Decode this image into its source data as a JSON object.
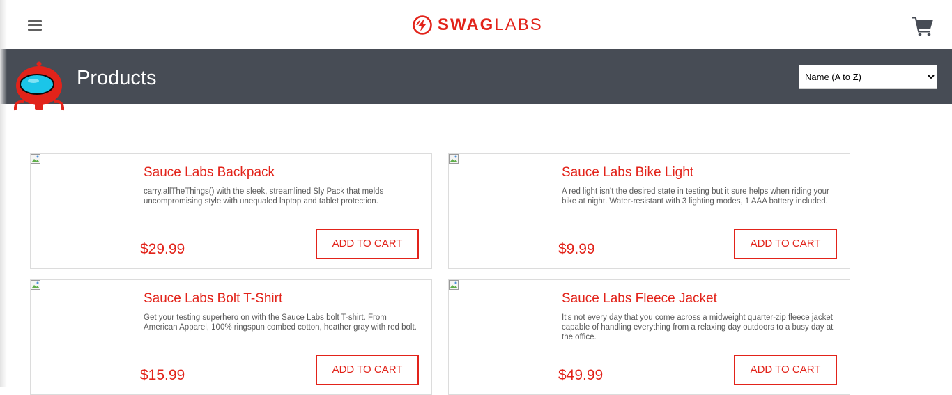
{
  "header": {
    "logo_bold": "SWAG",
    "logo_light": "LABS",
    "menu_icon": "hamburger-menu-icon",
    "cart_icon": "shopping-cart-icon",
    "brand_color": "#e2231a"
  },
  "subheader": {
    "title": "Products",
    "mascot_icon": "robot-mascot-icon",
    "background": "#474c55"
  },
  "sort": {
    "selected": "Name (A to Z)",
    "options": [
      "Name (A to Z)"
    ]
  },
  "products": [
    {
      "name": "Sauce Labs Backpack",
      "description": "carry.allTheThings() with the sleek, streamlined Sly Pack that melds uncompromising style with unequaled laptop and tablet protection.",
      "price": "$29.99",
      "button": "ADD TO CART"
    },
    {
      "name": "Sauce Labs Bike Light",
      "description": "A red light isn't the desired state in testing but it sure helps when riding your bike at night. Water-resistant with 3 lighting modes, 1 AAA battery included.",
      "price": "$9.99",
      "button": "ADD TO CART"
    },
    {
      "name": "Sauce Labs Bolt T-Shirt",
      "description": "Get your testing superhero on with the Sauce Labs bolt T-shirt. From American Apparel, 100% ringspun combed cotton, heather gray with red bolt.",
      "price": "$15.99",
      "button": "ADD TO CART"
    },
    {
      "name": "Sauce Labs Fleece Jacket",
      "description": "It's not every day that you come across a midweight quarter-zip fleece jacket capable of handling everything from a relaxing day outdoors to a busy day at the office.",
      "price": "$49.99",
      "button": "ADD TO CART"
    }
  ]
}
